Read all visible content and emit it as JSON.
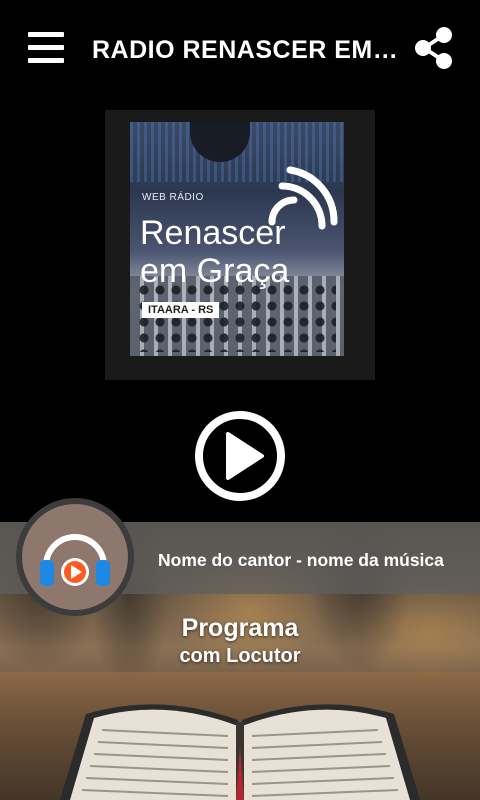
{
  "header": {
    "title": "RADIO RENASCER EM ...",
    "menu_icon": "hamburger-menu-icon",
    "share_icon": "share-icon"
  },
  "logo": {
    "kicker": "WEB RÁDIO",
    "line1": "Renascer",
    "line2": "em Graça",
    "badge": "ITAARA - RS"
  },
  "player": {
    "play_icon": "play-icon",
    "now_playing": "Nome do cantor - nome da música",
    "program_title": "Programa",
    "program_host": "com Locutor",
    "avatar_icon": "headphones-icon"
  },
  "colors": {
    "background": "#000000",
    "text": "#ffffff",
    "headphones_orange": "#ff5a1f",
    "headphones_blue": "#1e88e5",
    "avatar_bg": "#8e776c"
  }
}
